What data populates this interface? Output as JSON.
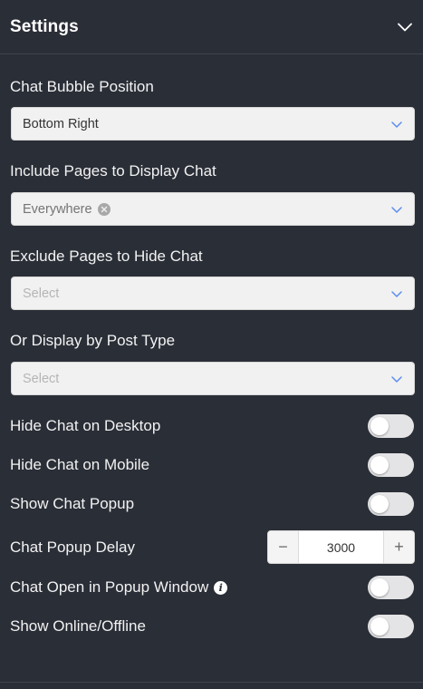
{
  "header": {
    "title": "Settings",
    "collapse_icon": "chevron-down-icon"
  },
  "fields": {
    "bubble_position": {
      "label": "Chat Bubble Position",
      "value": "Bottom Right"
    },
    "include_pages": {
      "label": "Include Pages to Display Chat",
      "tag": "Everywhere"
    },
    "exclude_pages": {
      "label": "Exclude Pages to Hide Chat",
      "placeholder": "Select"
    },
    "post_type": {
      "label": "Or Display by Post Type",
      "placeholder": "Select"
    }
  },
  "toggles": {
    "hide_desktop": {
      "label": "Hide Chat on Desktop",
      "on": false
    },
    "hide_mobile": {
      "label": "Hide Chat on Mobile",
      "on": false
    },
    "show_popup": {
      "label": "Show Chat Popup",
      "on": false
    },
    "popup_window": {
      "label": "Chat Open in Popup Window",
      "on": false
    },
    "online_offline": {
      "label": "Show Online/Offline",
      "on": false
    }
  },
  "popup_delay": {
    "label": "Chat Popup Delay",
    "value": "3000",
    "minus": "−",
    "plus": "+"
  },
  "colors": {
    "background": "#2a2e37",
    "chevron": "#5b8def",
    "toggle_off": "#e4e4e6"
  }
}
